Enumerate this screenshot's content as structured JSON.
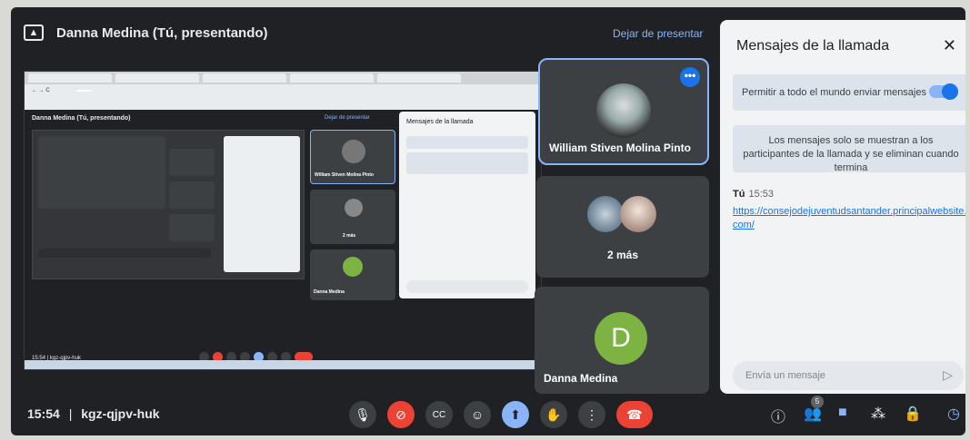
{
  "presenter": {
    "title": "Danna Medina (Tú, presentando)",
    "stop_label": "Dejar de presentar"
  },
  "inner_meet": {
    "title": "Danna Medina (Tú, presentando)",
    "stop_label": "Dejar de presentar",
    "chat_title": "Mensajes de la llamada",
    "clock": "15:54 | kgz-qjpv-huk",
    "tile_william": "William Stiven Molina Pinto",
    "tile_more": "2 más",
    "tile_danna": "Danna Medina"
  },
  "tiles": {
    "william": {
      "name": "William Stiven Molina Pinto"
    },
    "more": {
      "label": "2 más"
    },
    "danna": {
      "name": "Danna Medina",
      "initial": "D"
    }
  },
  "chat": {
    "title": "Mensajes de la llamada",
    "toggle_label": "Permitir a todo el mundo enviar mensajes",
    "info": "Los mensajes solo se muestran a los participantes de la llamada y se eliminan cuando termina",
    "message": {
      "sender": "Tú",
      "time": "15:53",
      "link": "https://consejodejuventudsantander.principalwebsite.com/"
    },
    "input_placeholder": "Envía un mensaje"
  },
  "toolbar": {
    "clock": "15:54",
    "separator": "|",
    "meeting_code": "kgz-qjpv-huk",
    "participants_count": "5"
  },
  "colors": {
    "accent": "#8ab4f8",
    "danger": "#ea4335",
    "danna_avatar": "#7cb342"
  }
}
